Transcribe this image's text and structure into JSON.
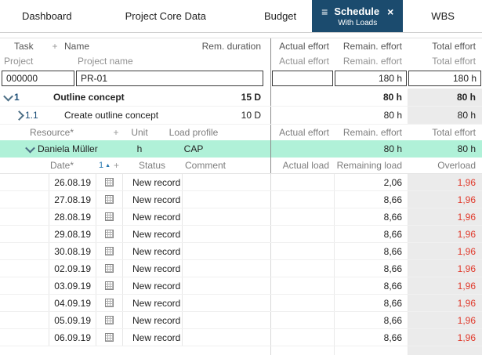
{
  "tabs": [
    {
      "label": "Dashboard"
    },
    {
      "label": "Project Core Data"
    },
    {
      "label": "Budget"
    },
    {
      "label": "Schedule",
      "sublabel": "With Loads"
    },
    {
      "label": "WBS"
    }
  ],
  "icons": {
    "menu": "≡",
    "close": "×",
    "plus": "+",
    "sort_number": "1",
    "sort_arrow": "▲"
  },
  "effort_headers": {
    "actual": "Actual effort",
    "remain": "Remain. effort",
    "total": "Total effort"
  },
  "task_header": {
    "task": "Task",
    "name": "Name",
    "duration": "Rem. duration"
  },
  "project_header": {
    "project": "Project",
    "name": "Project name"
  },
  "project": {
    "id": "000000",
    "name": "PR-01",
    "actual_effort": "",
    "remain_effort": "180 h",
    "total_effort": "180 h"
  },
  "tasks": [
    {
      "number": "1",
      "name": "Outline concept",
      "duration": "15 D",
      "remain_effort": "80 h",
      "total_effort": "80 h"
    },
    {
      "number": "1.1",
      "name": "Create outline concept",
      "duration": "10 D",
      "remain_effort": "80 h",
      "total_effort": "80 h"
    }
  ],
  "resource_header": {
    "resource": "Resource*",
    "unit": "Unit",
    "load_profile": "Load profile"
  },
  "resource": {
    "name": "Daniela Müller",
    "unit": "h",
    "load_profile": "CAP",
    "remain_effort": "80 h",
    "total_effort": "80 h"
  },
  "load_header": {
    "date": "Date*",
    "status": "Status",
    "comment": "Comment",
    "actual": "Actual load",
    "remaining": "Remaining load",
    "overload": "Overload"
  },
  "load_rows": [
    {
      "date": "26.08.19",
      "status": "New record",
      "remaining_load": "2,06",
      "overload": "1,96"
    },
    {
      "date": "27.08.19",
      "status": "New record",
      "remaining_load": "8,66",
      "overload": "1,96"
    },
    {
      "date": "28.08.19",
      "status": "New record",
      "remaining_load": "8,66",
      "overload": "1,96"
    },
    {
      "date": "29.08.19",
      "status": "New record",
      "remaining_load": "8,66",
      "overload": "1,96"
    },
    {
      "date": "30.08.19",
      "status": "New record",
      "remaining_load": "8,66",
      "overload": "1,96"
    },
    {
      "date": "02.09.19",
      "status": "New record",
      "remaining_load": "8,66",
      "overload": "1,96"
    },
    {
      "date": "03.09.19",
      "status": "New record",
      "remaining_load": "8,66",
      "overload": "1,96"
    },
    {
      "date": "04.09.19",
      "status": "New record",
      "remaining_load": "8,66",
      "overload": "1,96"
    },
    {
      "date": "05.09.19",
      "status": "New record",
      "remaining_load": "8,66",
      "overload": "1,96"
    },
    {
      "date": "06.09.19",
      "status": "New record",
      "remaining_load": "8,66",
      "overload": "1,96"
    }
  ],
  "colors": {
    "active_tab": "#1b4b6e",
    "resource_row": "#b0f1d8",
    "overload_text": "#e03a2c"
  }
}
